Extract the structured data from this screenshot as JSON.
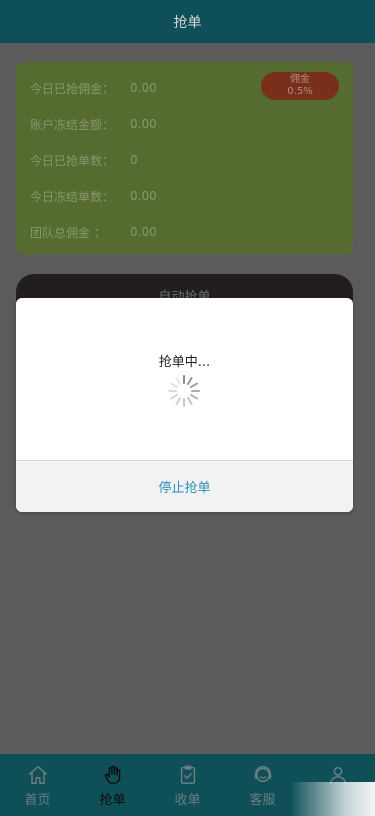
{
  "header": {
    "title": "抢单"
  },
  "stats": {
    "rows": [
      {
        "label": "今日已抢佣金：",
        "value": "0.00"
      },
      {
        "label": "账户冻结金额：",
        "value": "0.00"
      },
      {
        "label": "今日已抢单数：",
        "value": "0"
      },
      {
        "label": "今日冻结单数：",
        "value": "0.00"
      },
      {
        "label": "团队总佣金 ：",
        "value": "0.00"
      }
    ],
    "badge": {
      "line1": "佣金",
      "line2": "0.5%"
    }
  },
  "auto_card": {
    "title": "自动抢单"
  },
  "modal": {
    "message": "抢单中...",
    "button": "停止抢单"
  },
  "tabbar": {
    "tabs": [
      {
        "label": "首页",
        "icon": "home-icon"
      },
      {
        "label": "抢单",
        "icon": "hand-icon"
      },
      {
        "label": "收单",
        "icon": "clipboard-check-icon"
      },
      {
        "label": "客服",
        "icon": "customer-service-icon"
      },
      {
        "label": "",
        "icon": "user-icon"
      }
    ],
    "active_index": 1
  },
  "colors": {
    "header_bg": "#0e4f58",
    "overlay": "#5b5b5b",
    "stats_bg": "#556b2f",
    "badge_bg": "#7a2f1a",
    "link": "#2e8fbd"
  }
}
